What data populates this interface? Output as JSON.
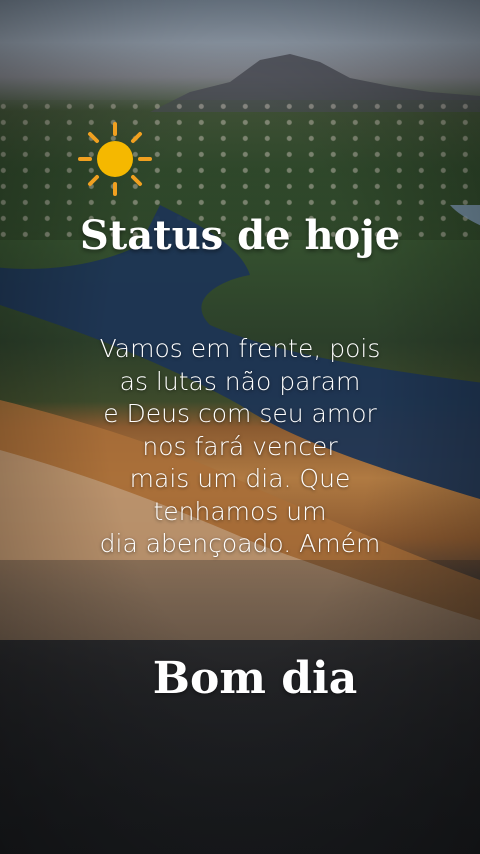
{
  "card": {
    "headline": "Status de hoje",
    "message_lines": [
      "Vamos em frente, pois",
      "as lutas não param",
      "e Deus com seu amor",
      "nos fará vencer",
      "mais um dia. Que",
      "tenhamos um",
      "dia abençoado. Amém"
    ],
    "greeting": "Bom dia",
    "icon": "sun-icon"
  },
  "colors": {
    "text": "#ffffff",
    "sun_core": "#f5b800",
    "sun_rays": "#f0a020"
  }
}
